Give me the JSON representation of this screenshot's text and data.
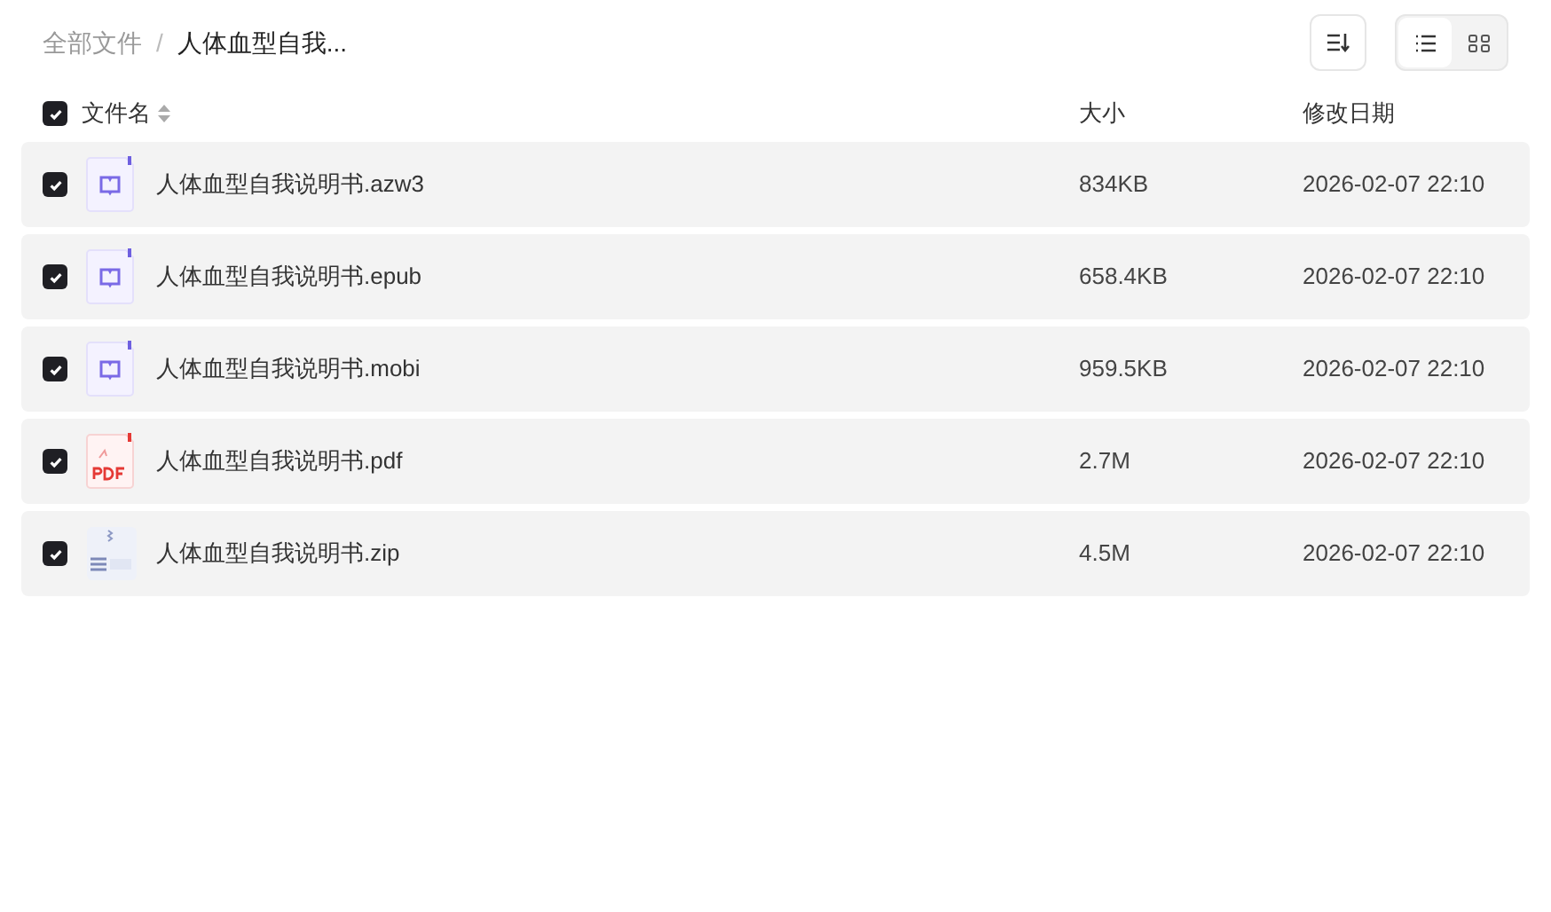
{
  "breadcrumb": [
    {
      "label": "全部文件",
      "current": false
    },
    {
      "label": "人体血型自我...",
      "current": true
    }
  ],
  "breadcrumb_separator": "/",
  "view_modes": [
    {
      "kind": "list",
      "selected": true
    },
    {
      "kind": "grid",
      "selected": false
    }
  ],
  "table": {
    "select_all": {
      "checked": true
    },
    "columns": [
      "文件名",
      "大小",
      "修改日期"
    ],
    "rows": [
      {
        "checked": true,
        "kind": "ebook",
        "name": "人体血型自我说明书.azw3",
        "size": "834KB",
        "modified": "2026-02-07 22:10"
      },
      {
        "checked": true,
        "kind": "ebook",
        "name": "人体血型自我说明书.epub",
        "size": "658.4KB",
        "modified": "2026-02-07 22:10"
      },
      {
        "checked": true,
        "kind": "ebook",
        "name": "人体血型自我说明书.mobi",
        "size": "959.5KB",
        "modified": "2026-02-07 22:10"
      },
      {
        "checked": true,
        "kind": "pdf",
        "name": "人体血型自我说明书.pdf",
        "size": "2.7M",
        "modified": "2026-02-07 22:10"
      },
      {
        "checked": true,
        "kind": "zip",
        "name": "人体血型自我说明书.zip",
        "size": "4.5M",
        "modified": "2026-02-07 22:10"
      }
    ]
  }
}
